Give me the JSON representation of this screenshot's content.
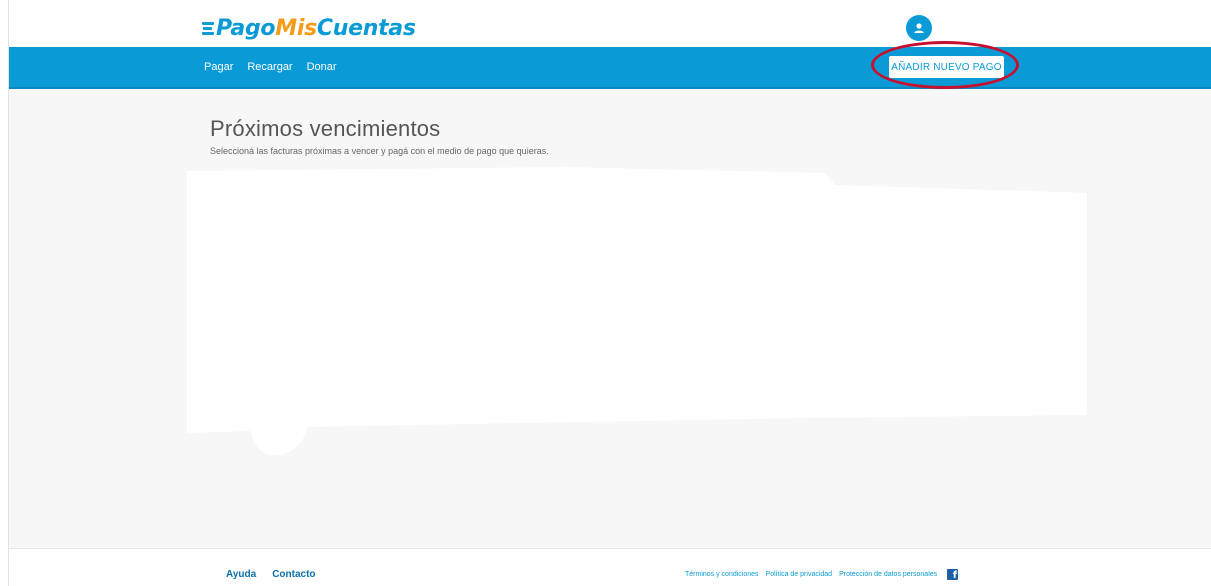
{
  "brand": {
    "logo_part1": "Pago",
    "logo_part2": "Mis",
    "logo_part3": "Cuentas",
    "primary_color": "#0a9bd6",
    "accent_color": "#f39c1a"
  },
  "header": {
    "avatar_icon": "user-icon"
  },
  "nav": {
    "items": [
      {
        "label": "Pagar"
      },
      {
        "label": "Recargar"
      },
      {
        "label": "Donar"
      }
    ],
    "add_button_label": "AÑADIR NUEVO PAGO",
    "highlight_color": "#c8102e"
  },
  "main": {
    "title": "Próximos vencimientos",
    "subtitle": "Seleccioná las facturas próximas a vencer y pagá con el medio de pago que quieras."
  },
  "footer": {
    "left_links": [
      {
        "label": "Ayuda"
      },
      {
        "label": "Contacto"
      }
    ],
    "right_links": [
      {
        "label": "Términos y condiciones"
      },
      {
        "label": "Política de privacidad"
      },
      {
        "label": "Protección de datos personales"
      }
    ],
    "social_icon": "facebook-icon"
  }
}
